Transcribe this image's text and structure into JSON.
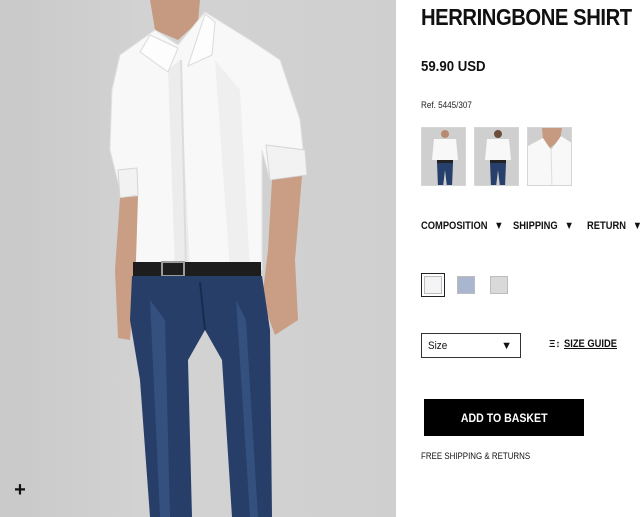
{
  "product": {
    "title": "HERRINGBONE SHIRT",
    "price": "59.90 USD",
    "ref": "Ref. 5445/307",
    "image_alt": "model wearing white herringbone shirt and jeans"
  },
  "thumbnails": [
    {
      "label": "front-full"
    },
    {
      "label": "back-full"
    },
    {
      "label": "collar-detail"
    }
  ],
  "tabs": [
    {
      "label": "COMPOSITION",
      "icon": "chevron-down-icon"
    },
    {
      "label": "SHIPPING",
      "icon": "chevron-down-icon"
    },
    {
      "label": "RETURN",
      "icon": "chevron-down-icon"
    }
  ],
  "swatches": [
    {
      "color": "#f4f4f6",
      "selected": true
    },
    {
      "color": "#a9b6cf",
      "selected": false
    },
    {
      "color": "#d9d9d9",
      "selected": false
    }
  ],
  "size_select": {
    "value": "Size",
    "icon": "chevron-down-icon"
  },
  "size_guide": {
    "label": "SIZE GUIDE",
    "icon": "ruler-icon"
  },
  "add_button": {
    "label": "ADD TO BASKET"
  },
  "shipping_note": "FREE SHIPPING & RETURNS",
  "zoom": {
    "icon": "plus-icon",
    "glyph": "+"
  },
  "colors": {
    "button_bg": "#000000",
    "text": "#111111",
    "photo_bg": "#cfcfcf"
  }
}
